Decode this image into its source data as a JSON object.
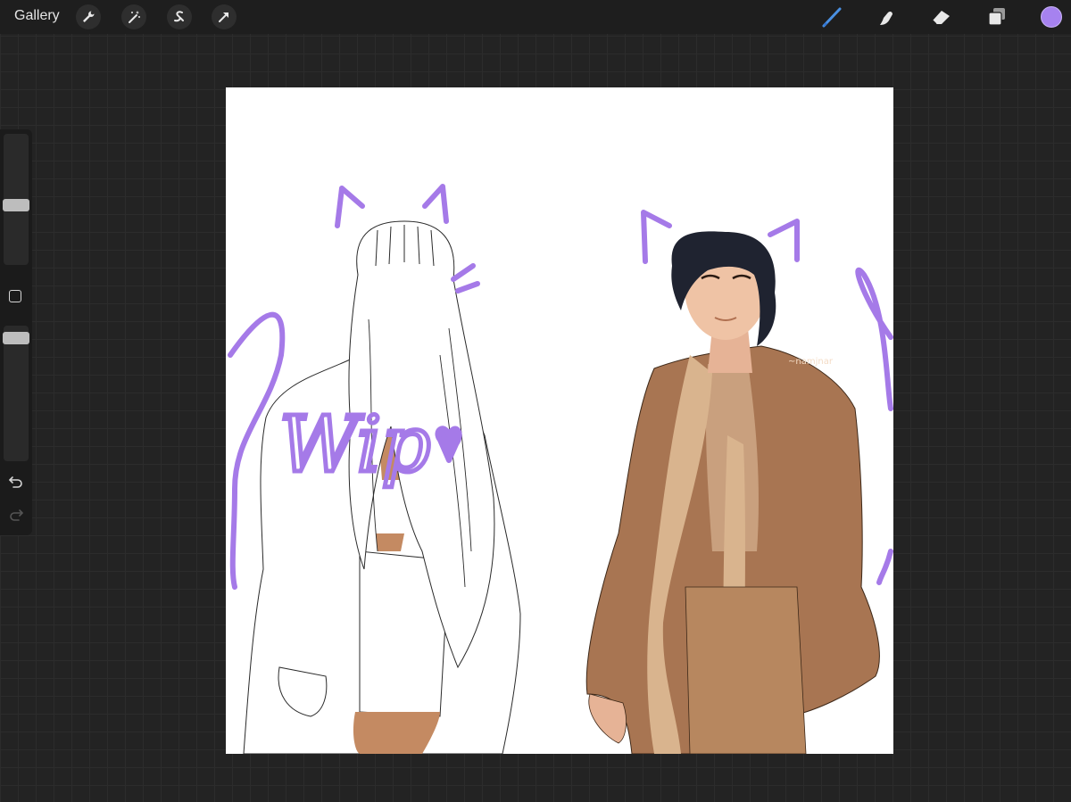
{
  "app": {
    "gallery_label": "Gallery"
  },
  "toolbar": {
    "left_tools": [
      "actions-icon",
      "adjustments-icon",
      "selection-icon",
      "transform-icon"
    ],
    "right_tools": [
      "brush-icon",
      "smudge-icon",
      "eraser-icon",
      "layers-icon"
    ],
    "current_color": "#a682ef",
    "active_tool_color": "#4a90e2"
  },
  "sidebar": {
    "brush_size_level": 0.45,
    "brush_opacity_level": 0.95,
    "controls": [
      "undo-icon",
      "redo-icon"
    ]
  },
  "canvas": {
    "background": "#ffffff",
    "handwritten_text": "Wip",
    "signature_text": "~namjnar"
  }
}
